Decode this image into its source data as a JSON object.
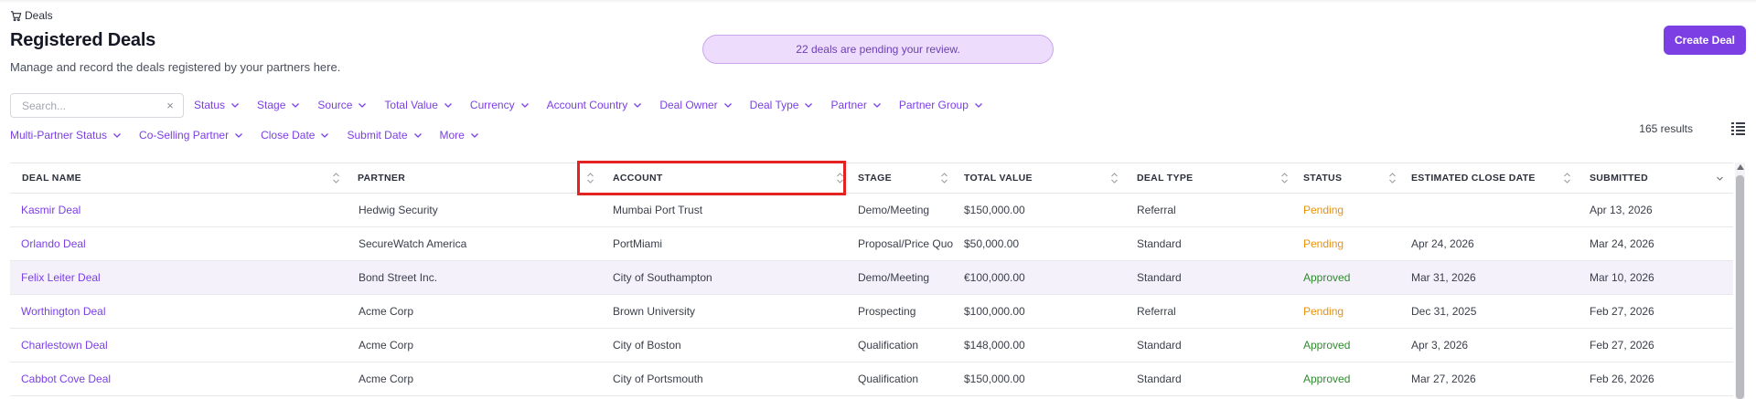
{
  "breadcrumb": {
    "label": "Deals"
  },
  "header": {
    "title": "Registered Deals",
    "subtitle": "Manage and record the deals registered by your partners here.",
    "pending_banner": "22 deals are pending your review.",
    "create_button": "Create Deal"
  },
  "search": {
    "placeholder": "Search...",
    "clear": "×"
  },
  "filters_row1": [
    "Status",
    "Stage",
    "Source",
    "Total Value",
    "Currency",
    "Account Country",
    "Deal Owner",
    "Deal Type",
    "Partner",
    "Partner Group"
  ],
  "filters_row2": [
    "Multi-Partner Status",
    "Co-Selling Partner",
    "Close Date",
    "Submit Date",
    "More"
  ],
  "results": "165 results",
  "table": {
    "columns": [
      "DEAL NAME",
      "PARTNER",
      "ACCOUNT",
      "STAGE",
      "TOTAL VALUE",
      "DEAL TYPE",
      "STATUS",
      "ESTIMATED CLOSE DATE",
      "SUBMITTED"
    ],
    "rows": [
      {
        "deal": "Kasmir Deal",
        "partner": "Hedwig Security",
        "account": "Mumbai Port Trust",
        "stage": "Demo/Meeting",
        "value": "$150,000.00",
        "type": "Referral",
        "status": "Pending",
        "close": "",
        "submitted": "Apr 13, 2026"
      },
      {
        "deal": "Orlando Deal",
        "partner": "SecureWatch America",
        "account": "PortMiami",
        "stage": "Proposal/Price Quo",
        "value": "$50,000.00",
        "type": "Standard",
        "status": "Pending",
        "close": "Apr 24, 2026",
        "submitted": "Mar 24, 2026"
      },
      {
        "deal": "Felix Leiter Deal",
        "partner": "Bond Street Inc.",
        "account": "City of Southampton",
        "stage": "Demo/Meeting",
        "value": "€100,000.00",
        "type": "Standard",
        "status": "Approved",
        "close": "Mar 31, 2026",
        "submitted": "Mar 10, 2026"
      },
      {
        "deal": "Worthington Deal",
        "partner": "Acme Corp",
        "account": "Brown University",
        "stage": "Prospecting",
        "value": "$100,000.00",
        "type": "Referral",
        "status": "Pending",
        "close": "Dec 31, 2025",
        "submitted": "Feb 27, 2026"
      },
      {
        "deal": "Charlestown Deal",
        "partner": "Acme Corp",
        "account": "City of Boston",
        "stage": "Qualification",
        "value": "$148,000.00",
        "type": "Standard",
        "status": "Approved",
        "close": "Apr 3, 2026",
        "submitted": "Feb 27, 2026"
      },
      {
        "deal": "Cabbot Cove Deal",
        "partner": "Acme Corp",
        "account": "City of Portsmouth",
        "stage": "Qualification",
        "value": "$150,000.00",
        "type": "Standard",
        "status": "Approved",
        "close": "Mar 27, 2026",
        "submitted": "Feb 26, 2026"
      }
    ]
  },
  "colors": {
    "accent": "#7b3fe4",
    "pending": "#e8920c",
    "approved": "#2f8a2f",
    "highlight": "#e32222"
  }
}
